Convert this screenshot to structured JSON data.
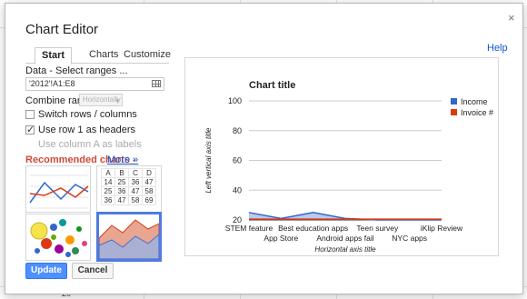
{
  "dialog": {
    "title": "Chart Editor",
    "close_glyph": "×",
    "help_label": "Help"
  },
  "tabs": [
    "Start",
    "Charts",
    "Customize"
  ],
  "active_tab": "Start",
  "data_section": {
    "label": "Data - Select ranges ...",
    "range_value": "'2012'!A1:E8",
    "grid_icon": "grid-select-icon"
  },
  "combine": {
    "label": "Combine ranges:",
    "value": "Horizontally",
    "arrow": "▾"
  },
  "options": [
    {
      "label": "Switch rows / columns",
      "checked": false,
      "disabled": false
    },
    {
      "label": "Use row 1 as headers",
      "checked": true,
      "disabled": false
    },
    {
      "label": "Use column A as labels",
      "checked": false,
      "disabled": true
    }
  ],
  "recommended": {
    "label": "Recommended charts",
    "dash": "-",
    "more_label": "More »",
    "table_thumb": [
      [
        "A",
        "B",
        "C",
        "D"
      ],
      [
        "14",
        "25",
        "36",
        "47"
      ],
      [
        "25",
        "36",
        "47",
        "58"
      ],
      [
        "36",
        "47",
        "58",
        "69"
      ]
    ]
  },
  "buttons": {
    "update": "Update",
    "cancel": "Cancel"
  },
  "spreadsheet": {
    "row_label": "20"
  },
  "colors": {
    "income": "#3366cc",
    "invoice": "#dc3912",
    "accent": "#4d90fe",
    "title_red": "#d14836"
  },
  "chart_data": {
    "type": "area",
    "title": "Chart title",
    "xlabel": "Horizontal axis title",
    "ylabel": "Left vertical axis title",
    "categories": [
      "STEM feature",
      "App Store",
      "Best education apps",
      "Android apps fail",
      "Teen survey",
      "NYC apps",
      "iKlip Review"
    ],
    "series": [
      {
        "name": "Income",
        "color": "#3366cc",
        "values": [
          25,
          21,
          25,
          21,
          20,
          20,
          20
        ]
      },
      {
        "name": "Invoice #",
        "color": "#dc3912",
        "values": [
          20.5,
          20.5,
          20.5,
          20.5,
          20.5,
          20.5,
          20.5
        ]
      }
    ],
    "yticks": [
      20,
      40,
      60,
      80,
      100
    ],
    "ylim": [
      20,
      100
    ],
    "grid": true,
    "legend": "right"
  }
}
